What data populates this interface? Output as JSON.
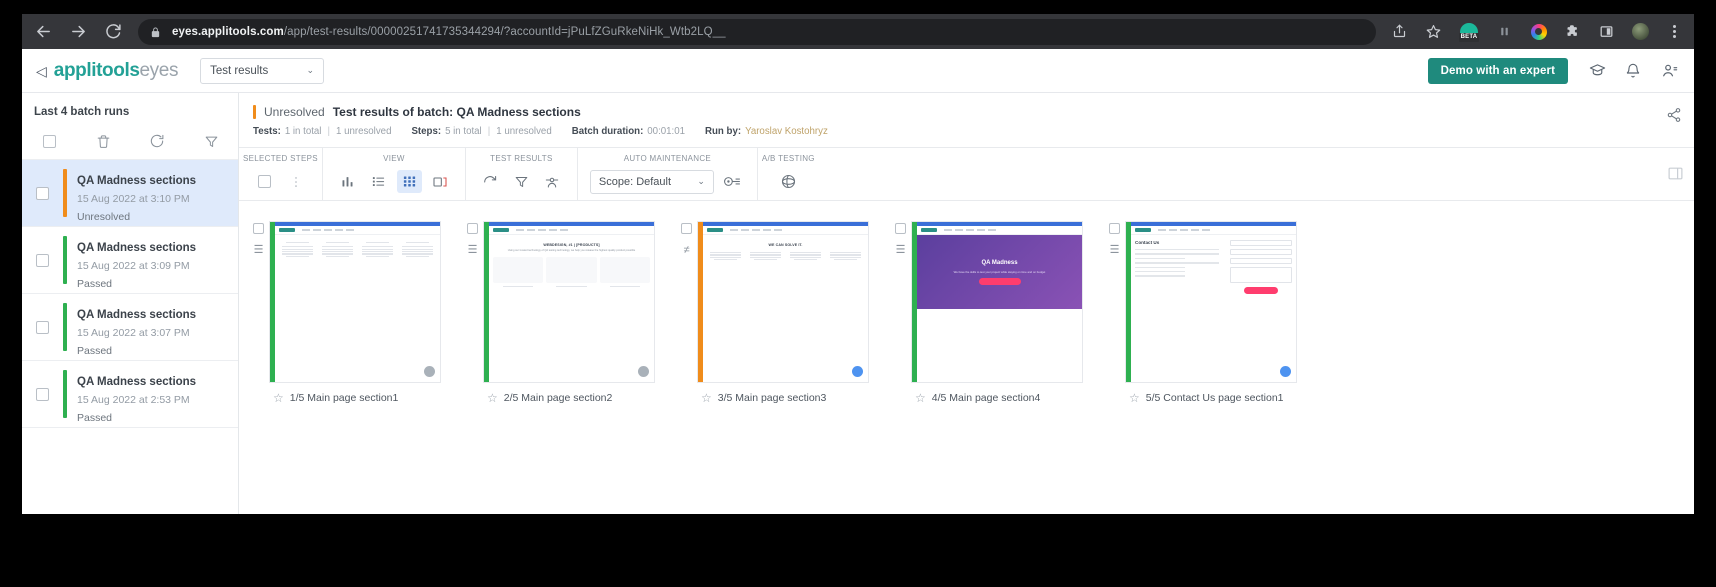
{
  "browser": {
    "url_bold": "eyes.applitools.com",
    "url_rest": "/app/test-results/00000251741735344294/?accountId=jPuLfZGuRkeNiHk_Wtb2LQ__",
    "back_icon": "back-arrow-icon",
    "forward_icon": "forward-arrow-icon",
    "reload_icon": "reload-icon",
    "lock_icon": "lock-icon",
    "share_icon": "share-icon",
    "bookmark_icon": "star-icon",
    "beta_badge_text": "BETA",
    "extensions_icon": "puzzle-icon",
    "sidepanel_icon": "side-panel-icon",
    "profile_icon": "profile-avatar",
    "menu_icon": "three-dot-menu-icon"
  },
  "header": {
    "logo_mark": "◁",
    "logo_primary": "applitools",
    "logo_secondary": "eyes",
    "view_select": "Test results",
    "chevron": "⌄",
    "demo_button": "Demo with an expert",
    "icons": [
      "graduation-cap-icon",
      "bell-icon",
      "account-icon"
    ]
  },
  "sidebar": {
    "title": "Last 4 batch runs",
    "toolbar_icons": [
      "select-all-checkbox",
      "delete-icon",
      "refresh-icon",
      "filter-icon"
    ],
    "items": [
      {
        "name": "QA Madness sections",
        "date": "15 Aug 2022 at 3:10 PM",
        "status": "Unresolved",
        "color": "#f08c1b",
        "selected": true
      },
      {
        "name": "QA Madness sections",
        "date": "15 Aug 2022 at 3:09 PM",
        "status": "Passed",
        "color": "#2eb050",
        "selected": false
      },
      {
        "name": "QA Madness sections",
        "date": "15 Aug 2022 at 3:07 PM",
        "status": "Passed",
        "color": "#2eb050",
        "selected": false
      },
      {
        "name": "QA Madness sections",
        "date": "15 Aug 2022 at 2:53 PM",
        "status": "Passed",
        "color": "#2eb050",
        "selected": false
      }
    ]
  },
  "batch": {
    "state": "Unresolved",
    "title": "Test results of batch:  QA Madness sections",
    "meta": {
      "tests_label": "Tests:",
      "tests_total": "1 in total",
      "tests_unresolved": "1 unresolved",
      "steps_label": "Steps:",
      "steps_total": "5 in total",
      "steps_unresolved": "1 unresolved",
      "duration_label": "Batch duration:",
      "duration_value": "00:01:01",
      "runby_label": "Run by:",
      "runby_value": "Yaroslav Kostohryz"
    },
    "share_icon": "share-network-icon"
  },
  "toolbar": {
    "groups": [
      {
        "label": "SELECTED STEPS",
        "icons": [
          {
            "name": "selected-steps-checkbox",
            "glyph": "checkbox",
            "state": "disabled"
          },
          {
            "name": "more-options-icon",
            "glyph": "⋮",
            "state": "disabled"
          }
        ]
      },
      {
        "label": "VIEW",
        "icons": [
          {
            "name": "chart-view-icon",
            "glyph": "chart",
            "state": "normal"
          },
          {
            "name": "list-view-icon",
            "glyph": "list",
            "state": "normal"
          },
          {
            "name": "grid-view-icon",
            "glyph": "grid",
            "state": "active"
          },
          {
            "name": "compare-view-icon",
            "glyph": "compare",
            "state": "normal"
          }
        ]
      },
      {
        "label": "TEST RESULTS",
        "icons": [
          {
            "name": "refresh-results-icon",
            "glyph": "refresh",
            "state": "normal"
          },
          {
            "name": "filter-results-icon",
            "glyph": "filter",
            "state": "normal"
          },
          {
            "name": "group-results-icon",
            "glyph": "group",
            "state": "normal"
          }
        ]
      },
      {
        "label": "AUTO MAINTENANCE",
        "scope_value": "Scope: Default",
        "scope_chevron": "⌄",
        "icons": [
          {
            "name": "auto-maintenance-run-icon",
            "glyph": "maintenance",
            "state": "normal"
          }
        ]
      },
      {
        "label": "A/B TESTING",
        "icons": [
          {
            "name": "ab-testing-icon",
            "glyph": "ab",
            "state": "normal"
          }
        ]
      }
    ],
    "right_icon": "panel-toggle-icon"
  },
  "steps": [
    {
      "caption": "1/5 Main page section1",
      "status_color": "#2eb050",
      "bar_color": "#3a6fd8",
      "star_icon": "star-outline-icon",
      "kind": "features"
    },
    {
      "caption": "2/5 Main page section2",
      "status_color": "#2eb050",
      "bar_color": "#3a6fd8",
      "star_icon": "star-outline-icon",
      "kind": "products"
    },
    {
      "caption": "3/5 Main page section3",
      "status_color": "#f08c1b",
      "bar_color": "#3a6fd8",
      "star_icon": "star-outline-icon",
      "kind": "services"
    },
    {
      "caption": "4/5 Main page section4",
      "status_color": "#2eb050",
      "bar_color": "#3a6fd8",
      "star_icon": "star-outline-icon",
      "kind": "hero"
    },
    {
      "caption": "5/5 Contact Us page section1",
      "status_color": "#2eb050",
      "bar_color": "#3a6fd8",
      "star_icon": "star-outline-icon",
      "kind": "contact"
    }
  ],
  "thumb_content": {
    "products_title": "WEBDESIGN, #1 | [PRODUCTS]",
    "products_sub": "Using our trusted technology of QA testing technology, we help you release the highest quality product possible",
    "services_title": "WE CAN SOLVE IT.",
    "hero_title": "QA Madness",
    "hero_sub": "We have the skills to test your project while staying on time and on budget",
    "contact_title": "Contact Us",
    "contact_lines": [
      "USA \"Fortune\" QA Madness™",
      "Headquarters: Torunska pl.av.12-13",
      "Vilnius 01000, Lithuania",
      "Technical offices: Lithuania, Poland & Ukraine",
      "+37060 4827 010",
      "hello@qamadness.com"
    ]
  }
}
